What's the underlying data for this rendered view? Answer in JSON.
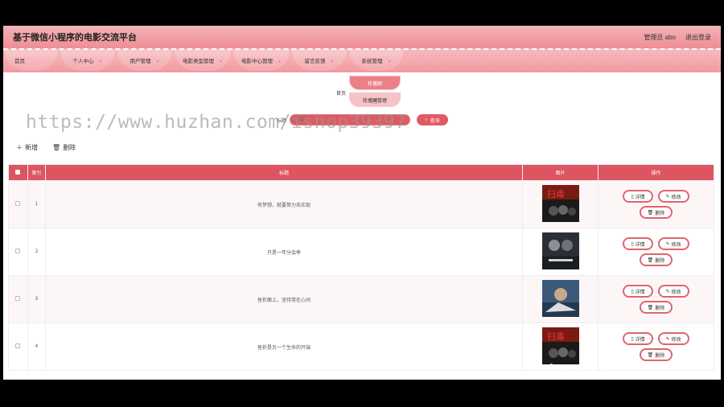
{
  "header": {
    "title": "基于微信小程序的电影交流平台",
    "admin_label": "管理员 abo",
    "logout_label": "退出登录"
  },
  "nav": [
    {
      "label": "首页",
      "chevron": false
    },
    {
      "label": "个人中心",
      "chevron": true
    },
    {
      "label": "用户管理",
      "chevron": true
    },
    {
      "label": "电影类型管理",
      "chevron": true
    },
    {
      "label": "电影中心管理",
      "chevron": true
    },
    {
      "label": "留言反馈",
      "chevron": true
    },
    {
      "label": "系统管理",
      "chevron": true
    }
  ],
  "dropdown": {
    "items": [
      "轮播图",
      "轮播图管理"
    ]
  },
  "breadcrumb": {
    "home": "首页"
  },
  "search": {
    "label": "标题",
    "placeholder": "标题",
    "button_label": "查询"
  },
  "watermark": "https://www.huzhan.com/ishop39397",
  "toolbar": {
    "add_label": "新增",
    "delete_label": "删除"
  },
  "table": {
    "headers": {
      "index": "索引",
      "title": "标题",
      "image": "图片",
      "actions": "操作"
    },
    "action_labels": {
      "detail": "详情",
      "edit": "修改",
      "delete": "删除"
    },
    "rows": [
      {
        "index": "1",
        "title": "有梦想，就要努力去实现"
      },
      {
        "index": "2",
        "title": "只是一年分会季"
      },
      {
        "index": "3",
        "title": "挫折面上，坚持常在心间"
      },
      {
        "index": "4",
        "title": "挫折是另一个生命的开端"
      }
    ]
  },
  "colors": {
    "accent": "#dc5560",
    "nav_bg": "#f19aa0",
    "header_bg": "#ee8e95"
  }
}
